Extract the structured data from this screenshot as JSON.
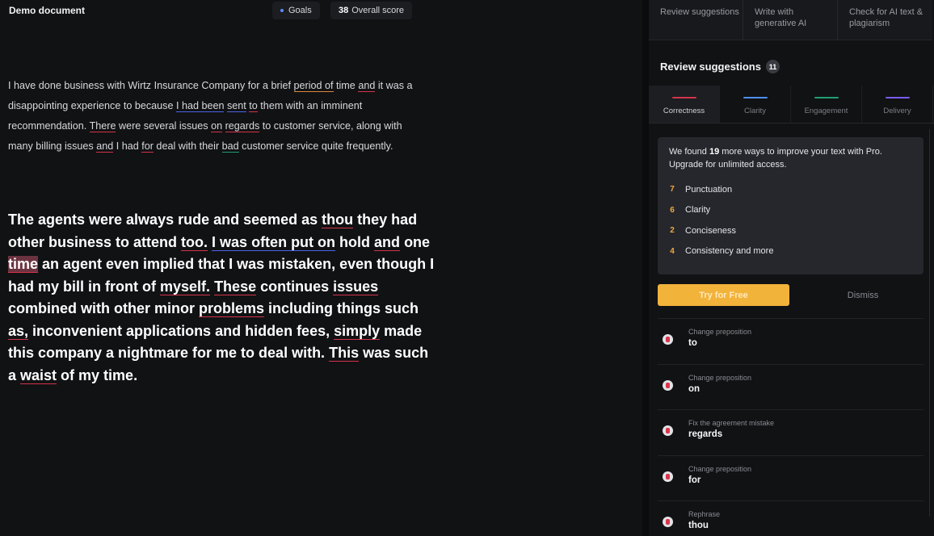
{
  "editor": {
    "doc_title": "Demo document",
    "goals_label": "Goals",
    "score_value": "38",
    "score_label": "Overall score",
    "para1": [
      {
        "t": "I have done business with Wirtz Insurance Company for a brief "
      },
      {
        "t": "period of",
        "u": "orange"
      },
      {
        "t": " time "
      },
      {
        "t": "and",
        "u": "red"
      },
      {
        "t": " it was a disappointing experience to because "
      },
      {
        "t": "I had been",
        "u": "blue"
      },
      {
        "t": " "
      },
      {
        "t": "sent",
        "u": "blue"
      },
      {
        "t": " "
      },
      {
        "t": "to",
        "u": "red"
      },
      {
        "t": " them with an imminent recommendation. "
      },
      {
        "t": " There",
        "u": "red"
      },
      {
        "t": " were several issues "
      },
      {
        "t": "on",
        "u": "red"
      },
      {
        "t": " "
      },
      {
        "t": "regards",
        "u": "red"
      },
      {
        "t": " to customer service, along with many billing issues "
      },
      {
        "t": "and",
        "u": "red"
      },
      {
        "t": " I had "
      },
      {
        "t": "for",
        "u": "red"
      },
      {
        "t": " deal with their "
      },
      {
        "t": "bad",
        "u": "green"
      },
      {
        "t": " customer service quite frequently."
      }
    ],
    "para2": [
      {
        "t": "The agents were always rude and seemed as "
      },
      {
        "t": "thou",
        "u": "red"
      },
      {
        "t": " they had other business to attend "
      },
      {
        "t": "too.",
        "u": "red"
      },
      {
        "t": " "
      },
      {
        "t": "I was often put on",
        "u": "blue"
      },
      {
        "t": " hold "
      },
      {
        "t": "and",
        "u": "red"
      },
      {
        "t": " one "
      },
      {
        "t": "time",
        "h": true
      },
      {
        "t": " an agent even implied that I was mistaken, even though I had my bill in front of "
      },
      {
        "t": "myself.",
        "u": "red"
      },
      {
        "t": " "
      },
      {
        "t": "These",
        "u": "red"
      },
      {
        "t": " continues "
      },
      {
        "t": "issues",
        "u": "red"
      },
      {
        "t": " combined with other minor "
      },
      {
        "t": "problems",
        "u": "red"
      },
      {
        "t": " including things such "
      },
      {
        "t": "as,",
        "u": "red"
      },
      {
        "t": " inconvenient applications and hidden fees, "
      },
      {
        "t": "simply",
        "u": "red"
      },
      {
        "t": " made this company a nightmare for me to deal with. "
      },
      {
        "t": " This",
        "u": "red"
      },
      {
        "t": " was such a "
      },
      {
        "t": "waist",
        "u": "red"
      },
      {
        "t": " of my time."
      }
    ]
  },
  "panel": {
    "mode_tabs": [
      {
        "label": "Review suggestions"
      },
      {
        "label": "Write with generative AI"
      },
      {
        "label": "Check for AI text & plagiarism"
      }
    ],
    "review_title": "Review suggestions",
    "review_count": "11",
    "category_tabs": [
      {
        "label": "Correctness",
        "color": "#d3344a",
        "active": true
      },
      {
        "label": "Clarity",
        "color": "#4c8ef0",
        "active": false
      },
      {
        "label": "Engagement",
        "color": "#1f9f72",
        "active": false
      },
      {
        "label": "Delivery",
        "color": "#7a5cf0",
        "active": false
      }
    ],
    "promo": {
      "text_pre": "We found ",
      "text_num": "19",
      "text_post": " more ways to improve your text with Pro. Upgrade for unlimited access.",
      "items": [
        {
          "count": "7",
          "label": "Punctuation"
        },
        {
          "count": "6",
          "label": "Clarity"
        },
        {
          "count": "2",
          "label": "Conciseness"
        },
        {
          "count": "4",
          "label": "Consistency and more"
        }
      ],
      "accent": "#f2a93b"
    },
    "try_label": "Try for Free",
    "dismiss_label": "Dismiss",
    "suggestions": [
      {
        "type": "Change preposition",
        "word": "to"
      },
      {
        "type": "Change preposition",
        "word": "on"
      },
      {
        "type": "Fix the agreement mistake",
        "word": "regards"
      },
      {
        "type": "Change preposition",
        "word": "for"
      },
      {
        "type": "Rephrase",
        "word": "thou"
      }
    ]
  }
}
